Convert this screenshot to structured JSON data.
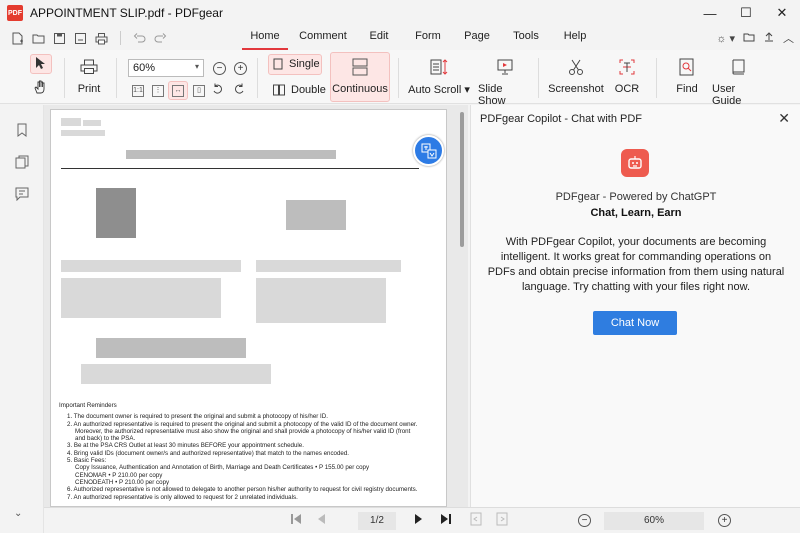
{
  "window": {
    "app_logo_text": "PDF",
    "title": "APPOINTMENT SLIP.pdf - PDFgear",
    "minimize": "—",
    "maximize": "☐",
    "close": "✕"
  },
  "menu": {
    "tabs": [
      {
        "label": "Home"
      },
      {
        "label": "Comment"
      },
      {
        "label": "Edit"
      },
      {
        "label": "Form"
      },
      {
        "label": "Page"
      },
      {
        "label": "Tools"
      },
      {
        "label": "Help"
      }
    ],
    "active_tab": "Home"
  },
  "toolbar": {
    "print": "Print",
    "zoom_value": "60%",
    "single": "Single",
    "double": "Double",
    "continuous": "Continuous",
    "auto_scroll": "Auto Scroll",
    "slide_show": "Slide Show",
    "screenshot": "Screenshot",
    "ocr": "OCR",
    "find": "Find",
    "user_guide": "User Guide"
  },
  "document": {
    "reminders_title": "Important Reminders",
    "reminders": [
      "1.  The document owner is required to present the original and submit a photocopy of his/her ID.",
      "2.  An authorized representative is required to present the original and submit a photocopy of the valid ID of the document owner. Moreover, the authorized representative must also show the original and shall provide a photocopy of his/her valid ID (front and back) to the PSA.",
      "3.  Be at the PSA CRS Outlet at least 30 minutes BEFORE your appointment schedule.",
      "4.  Bring valid IDs (document owner/s and authorized representative) that match to the names encoded.",
      "5.  Basic Fees:"
    ],
    "fees": [
      "Copy Issuance, Authentication and Annotation of Birth, Marriage and Death Certificates • P 155.00 per copy",
      "CENOMAR • P 210.00 per copy",
      "CENODEATH • P 210.00 per copy"
    ],
    "reminders_after": [
      "6.  Authorized representative is not allowed to delegate to another person his/her authority to request for civil registry documents.",
      "7.  An authorized representative is only allowed to request for 2 unrelated individuals."
    ]
  },
  "copilot": {
    "title": "PDFgear Copilot - Chat with PDF",
    "powered": "PDFgear - Powered by ChatGPT",
    "slogan": "Chat, Learn, Earn",
    "description": "With PDFgear Copilot, your documents are becoming intelligent. It works great for commanding operations on PDFs and obtain precise information from them using natural language. Try chatting with your files right now.",
    "button": "Chat Now"
  },
  "status": {
    "page_indicator": "1/2",
    "zoom": "60%"
  }
}
